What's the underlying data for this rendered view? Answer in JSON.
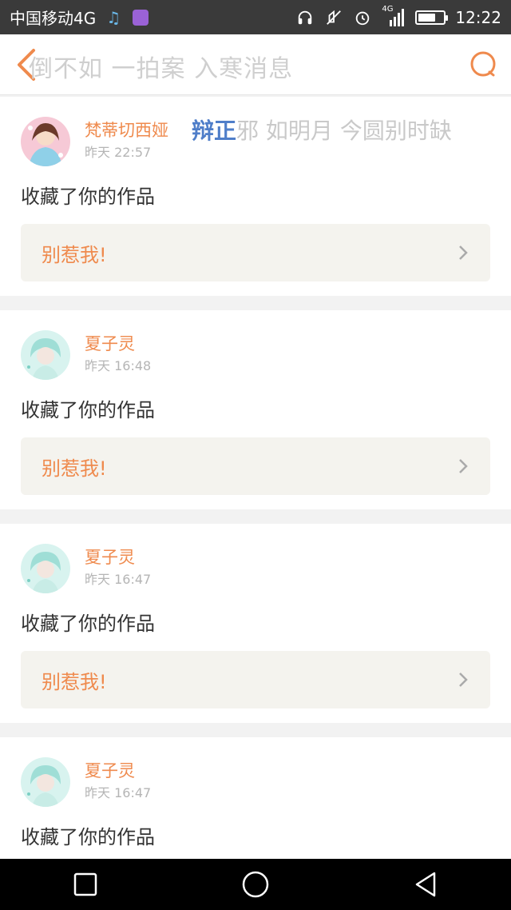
{
  "status_bar": {
    "carrier": "中国移动4G",
    "network_small": "4G",
    "time": "12:22",
    "battery_level": 0.7,
    "icons": [
      "music-note-icon",
      "image-icon",
      "headphones-icon",
      "mute-icon",
      "alarm-icon",
      "signal-icon",
      "battery-icon"
    ]
  },
  "header": {
    "title": "倒不如 一拍案 入寒消息",
    "back_icon": "chevron-left-icon",
    "search_icon": "search-icon"
  },
  "overlay": {
    "blue_part": "辩正",
    "rest": "邪 如明月 今圆别时缺"
  },
  "colors": {
    "accent": "#ef8a4d",
    "work_box_bg": "#f4f3ee",
    "status_bar_bg": "#3a3a3a",
    "page_bg": "#f2f2f2"
  },
  "feed": [
    {
      "username": "梵蒂切西娅",
      "time": "昨天 22:57",
      "action": "收藏了你的作品",
      "work_title": "别惹我!",
      "avatar": "girl-avatar"
    },
    {
      "username": "夏子灵",
      "time": "昨天 16:48",
      "action": "收藏了你的作品",
      "work_title": "别惹我!",
      "avatar": "anime-boy-avatar"
    },
    {
      "username": "夏子灵",
      "time": "昨天 16:47",
      "action": "收藏了你的作品",
      "work_title": "别惹我!",
      "avatar": "anime-boy-avatar"
    },
    {
      "username": "夏子灵",
      "time": "昨天 16:47",
      "action": "收藏了你的作品",
      "work_title": "",
      "avatar": "anime-boy-avatar"
    }
  ],
  "nav": [
    "recent-apps-icon",
    "home-icon",
    "back-icon"
  ]
}
